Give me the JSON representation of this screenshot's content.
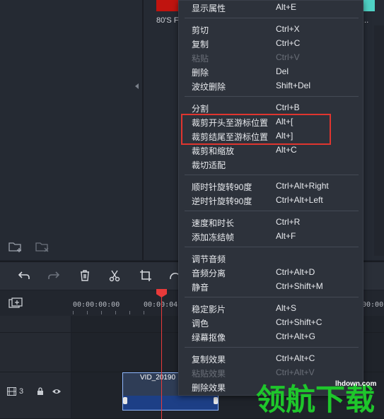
{
  "library": {
    "thumb1_label": "80'S F",
    "thumb2_label": "..."
  },
  "timeline": {
    "ruler_times": [
      "00:00:00:00",
      "00:00:04:0",
      "00:00:16"
    ],
    "track_number": "3",
    "clip_name": "VID_20190"
  },
  "menu": {
    "items": [
      {
        "label": "显示属性",
        "shortcut": "Alt+E",
        "disabled": false
      },
      {
        "label": "剪切",
        "shortcut": "Ctrl+X",
        "disabled": false
      },
      {
        "label": "复制",
        "shortcut": "Ctrl+C",
        "disabled": false
      },
      {
        "label": "粘贴",
        "shortcut": "Ctrl+V",
        "disabled": true
      },
      {
        "label": "删除",
        "shortcut": "Del",
        "disabled": false
      },
      {
        "label": "波纹删除",
        "shortcut": "Shift+Del",
        "disabled": false
      },
      {
        "label": "分割",
        "shortcut": "Ctrl+B",
        "disabled": false
      },
      {
        "label": "裁剪开头至游标位置",
        "shortcut": "Alt+[",
        "disabled": false
      },
      {
        "label": "裁剪结尾至游标位置",
        "shortcut": "Alt+]",
        "disabled": false
      },
      {
        "label": "裁剪和缩放",
        "shortcut": "Alt+C",
        "disabled": false
      },
      {
        "label": "裁切适配",
        "shortcut": "",
        "disabled": false
      },
      {
        "label": "顺时针旋转90度",
        "shortcut": "Ctrl+Alt+Right",
        "disabled": false
      },
      {
        "label": "逆时针旋转90度",
        "shortcut": "Ctrl+Alt+Left",
        "disabled": false
      },
      {
        "label": "速度和时长",
        "shortcut": "Ctrl+R",
        "disabled": false
      },
      {
        "label": "添加冻结帧",
        "shortcut": "Alt+F",
        "disabled": false
      },
      {
        "label": "调节音频",
        "shortcut": "",
        "disabled": false
      },
      {
        "label": "音频分离",
        "shortcut": "Ctrl+Alt+D",
        "disabled": false
      },
      {
        "label": "静音",
        "shortcut": "Ctrl+Shift+M",
        "disabled": false
      },
      {
        "label": "稳定影片",
        "shortcut": "Alt+S",
        "disabled": false
      },
      {
        "label": "调色",
        "shortcut": "Ctrl+Shift+C",
        "disabled": false
      },
      {
        "label": "绿幕抠像",
        "shortcut": "Ctrl+Alt+G",
        "disabled": false
      },
      {
        "label": "复制效果",
        "shortcut": "Ctrl+Alt+C",
        "disabled": false
      },
      {
        "label": "粘贴效果",
        "shortcut": "Ctrl+Alt+V",
        "disabled": true
      },
      {
        "label": "删除效果",
        "shortcut": "",
        "disabled": false
      }
    ]
  },
  "watermark": {
    "logo_text": "领航下载",
    "site": "lhdown.com"
  },
  "colors": {
    "highlight": "#e0352f",
    "playhead": "#e83a3a",
    "watermark_green": "#1ec62b"
  }
}
